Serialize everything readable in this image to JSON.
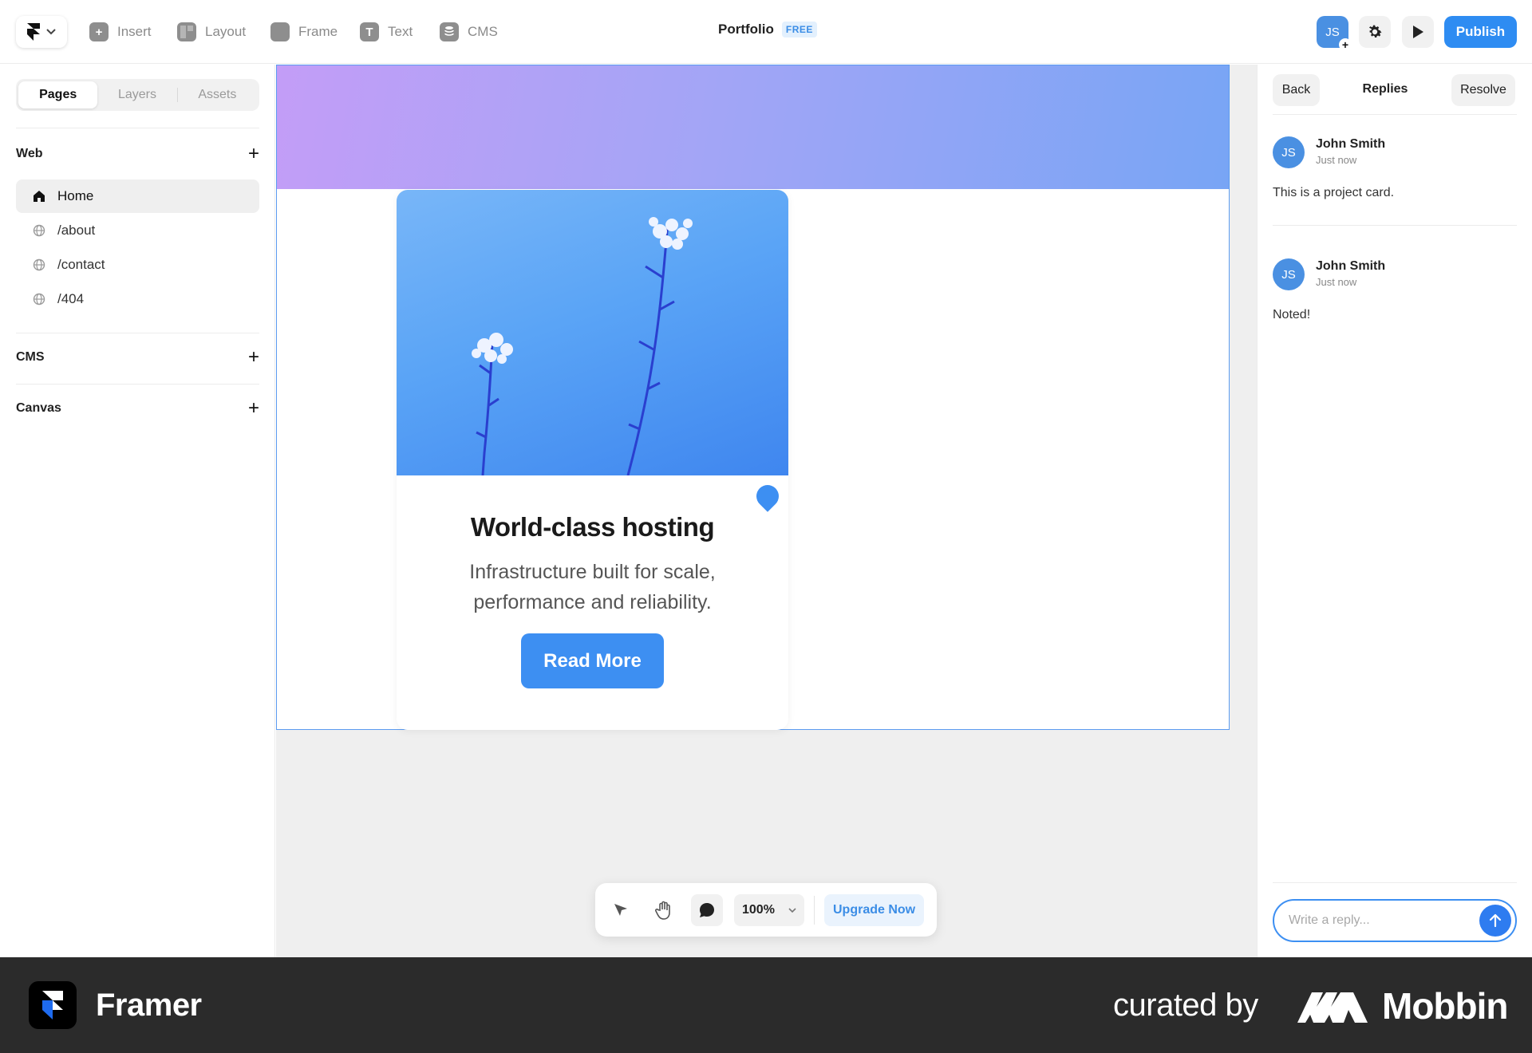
{
  "toolbar": {
    "insert": "Insert",
    "layout": "Layout",
    "frame": "Frame",
    "text": "Text",
    "cms": "CMS",
    "project_title": "Portfolio",
    "plan_badge": "FREE",
    "avatar_initials": "JS",
    "publish": "Publish"
  },
  "left_panel": {
    "tabs": [
      "Pages",
      "Layers",
      "Assets"
    ],
    "web_section": "Web",
    "pages": [
      "Home",
      "/about",
      "/contact",
      "/404"
    ],
    "cms_section": "CMS",
    "canvas_section": "Canvas"
  },
  "canvas": {
    "card_title": "World-class hosting",
    "card_description": "Infrastructure built for scale, performance and reliability.",
    "card_button": "Read More",
    "zoom": "100%",
    "upgrade": "Upgrade Now"
  },
  "comments_panel": {
    "back": "Back",
    "title": "Replies",
    "resolve": "Resolve",
    "comments": [
      {
        "initials": "JS",
        "author": "John Smith",
        "time": "Just now",
        "text": "This is a project card."
      },
      {
        "initials": "JS",
        "author": "John Smith",
        "time": "Just now",
        "text": "Noted!"
      }
    ],
    "reply_placeholder": "Write a reply..."
  },
  "footer": {
    "app_name": "Framer",
    "curated_by": "curated by",
    "brand": "Mobbin"
  },
  "colors": {
    "accent": "#2e8cf2",
    "banner_start": "#c39df7",
    "banner_end": "#78a5f5",
    "footer_bg": "#2b2b2b"
  }
}
